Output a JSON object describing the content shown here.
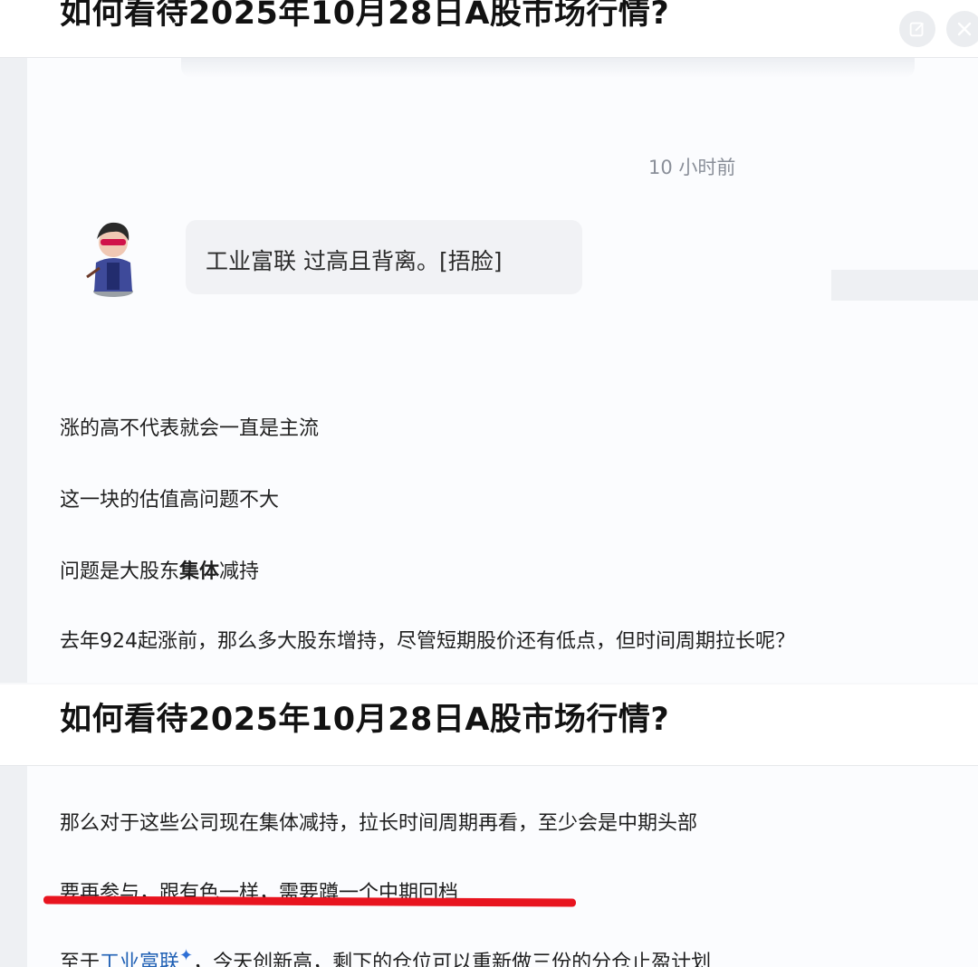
{
  "header": {
    "title": "如何看待2025年10月28日A股市场行情?",
    "edit_icon": "edit-icon",
    "close_icon": "close-icon"
  },
  "comment": {
    "timestamp": "10 小时前",
    "reply": "工业富联 过高且背离。[捂脸]"
  },
  "answer_a": {
    "lines": [
      "涨的高不代表就会一直是主流",
      "这一块的估值高问题不大",
      "问题是大股东",
      "集体",
      "减持",
      "去年924起涨前，那么多大股东增持，尽管短期股价还有低点，但时间周期拉长呢？"
    ]
  },
  "section_b": {
    "title": "如何看待2025年10月28日A股市场行情?",
    "lines": [
      "那么对于这些公司现在集体减持，拉长时间周期再看，至少会是中期头部",
      "要再参与，跟有色一样，需要蹲一个中期回档",
      "至于",
      "工业富联",
      "，今天创新高，剩下的仓位可以重新做三份的分仓止盈计划"
    ],
    "accent_color": "#e8141f",
    "link_color": "#1e5fb4"
  }
}
